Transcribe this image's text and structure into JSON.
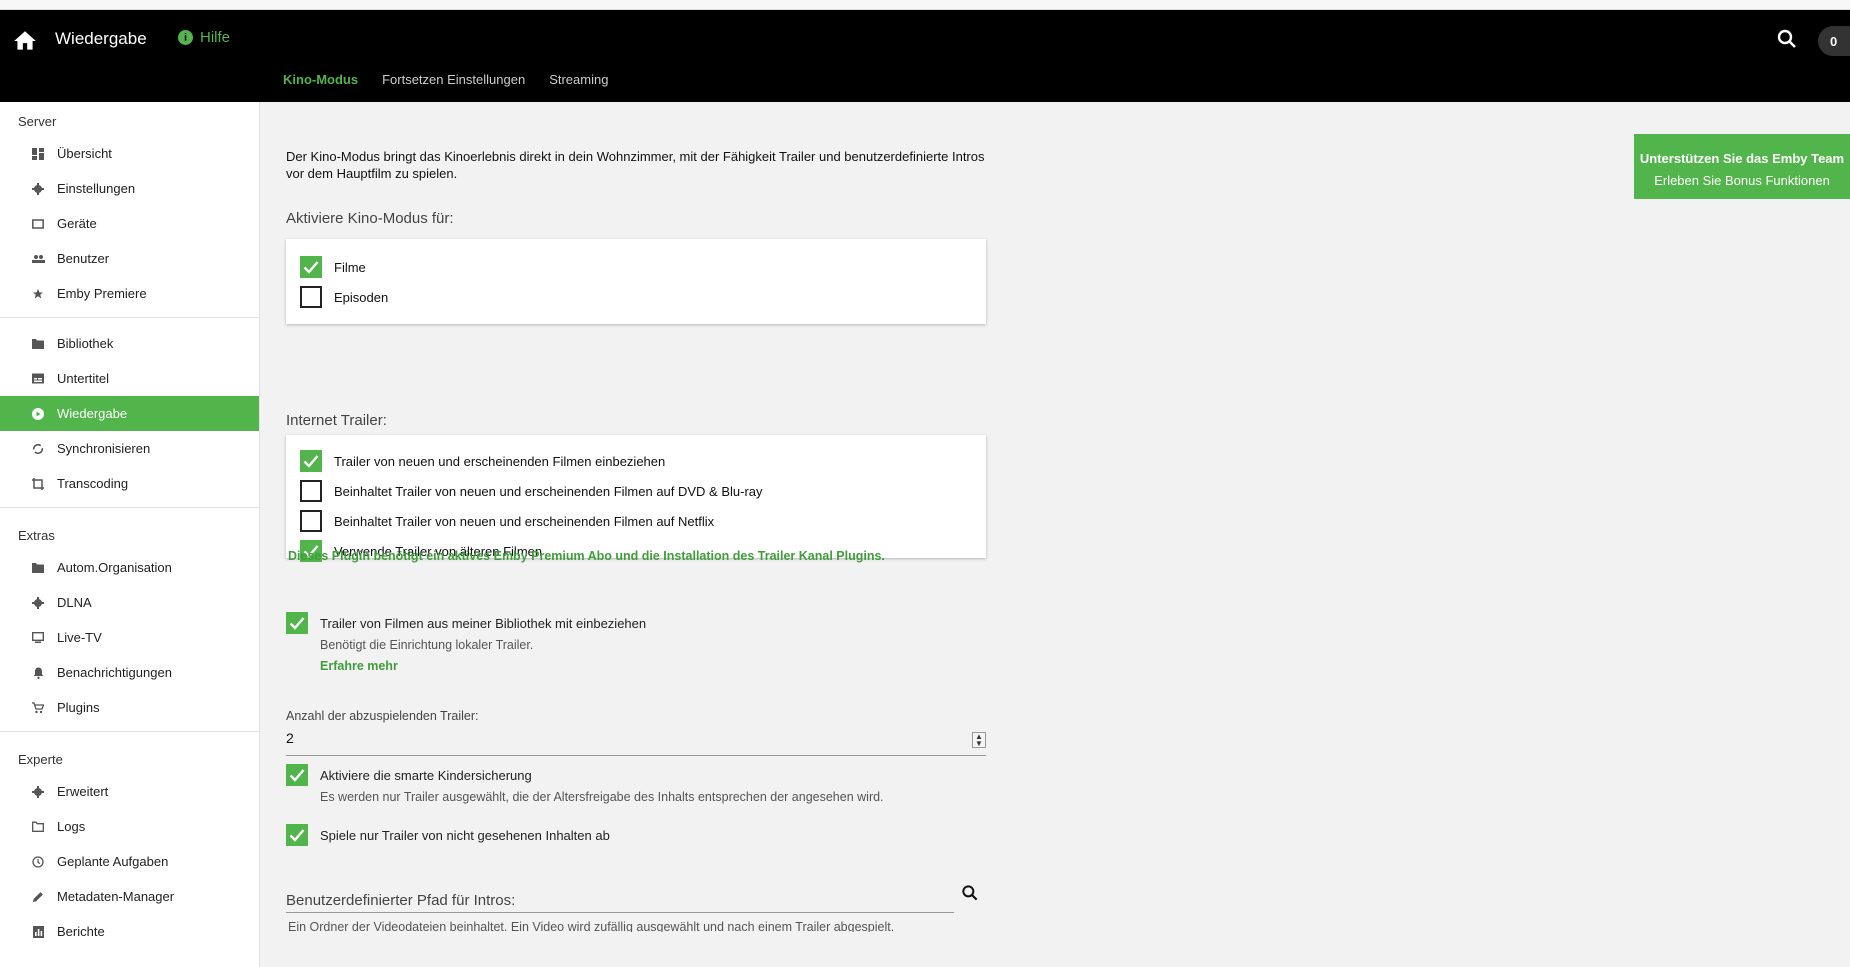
{
  "header": {
    "title": "Wiedergabe",
    "help_label": "Hilfe",
    "badge_count": "0",
    "tabs": [
      {
        "label": "Kino-Modus",
        "active": true
      },
      {
        "label": "Fortsetzen Einstellungen",
        "active": false
      },
      {
        "label": "Streaming",
        "active": false
      }
    ]
  },
  "sidebar": {
    "sections": [
      {
        "heading": "Server",
        "items": [
          {
            "label": "Übersicht",
            "icon": "dashboard-icon"
          },
          {
            "label": "Einstellungen",
            "icon": "gear-icon"
          },
          {
            "label": "Geräte",
            "icon": "devices-icon"
          },
          {
            "label": "Benutzer",
            "icon": "people-icon"
          },
          {
            "label": "Emby Premiere",
            "icon": "star-icon"
          }
        ]
      },
      {
        "heading": "",
        "items": [
          {
            "label": "Bibliothek",
            "icon": "folder-icon"
          },
          {
            "label": "Untertitel",
            "icon": "subtitles-icon"
          },
          {
            "label": "Wiedergabe",
            "icon": "play-circle-icon",
            "active": true
          },
          {
            "label": "Synchronisieren",
            "icon": "sync-icon"
          },
          {
            "label": "Transcoding",
            "icon": "transform-icon"
          }
        ]
      },
      {
        "heading": "Extras",
        "items": [
          {
            "label": "Autom.Organisation",
            "icon": "folder-icon"
          },
          {
            "label": "DLNA",
            "icon": "gear-icon"
          },
          {
            "label": "Live-TV",
            "icon": "tv-icon"
          },
          {
            "label": "Benachrichtigungen",
            "icon": "bell-icon"
          },
          {
            "label": "Plugins",
            "icon": "cart-icon"
          }
        ]
      },
      {
        "heading": "Experte",
        "items": [
          {
            "label": "Erweitert",
            "icon": "gear-icon"
          },
          {
            "label": "Logs",
            "icon": "folder-outline-icon"
          },
          {
            "label": "Geplante Aufgaben",
            "icon": "clock-icon"
          },
          {
            "label": "Metadaten-Manager",
            "icon": "pencil-icon"
          },
          {
            "label": "Berichte",
            "icon": "report-icon"
          }
        ]
      }
    ]
  },
  "support": {
    "line1": "Unterstützen Sie das Emby Team",
    "line2": "Erleben Sie Bonus Funktionen"
  },
  "main": {
    "intro": "Der Kino-Modus bringt das Kinoerlebnis direkt in dein Wohnzimmer, mit der Fähigkeit Trailer und benutzerdefinierte Intros vor dem Hauptfilm zu spielen.",
    "enable_heading": "Aktiviere Kino-Modus für:",
    "enable_options": [
      {
        "label": "Filme",
        "checked": true
      },
      {
        "label": "Episoden",
        "checked": false
      }
    ],
    "internet_heading": "Internet Trailer:",
    "internet_options": [
      {
        "label": "Trailer von neuen und erscheinenden Filmen einbeziehen",
        "checked": true
      },
      {
        "label": "Beinhaltet Trailer von neuen und erscheinenden Filmen auf DVD & Blu-ray",
        "checked": false
      },
      {
        "label": "Beinhaltet Trailer von neuen und erscheinenden Filmen auf Netflix",
        "checked": false
      },
      {
        "label": "Verwende Trailer von älteren Filmen",
        "checked": true
      }
    ],
    "plugin_note": "Dieses Plugin benötigt ein aktives Emby Premium Abo und die Installation des Trailer Kanal Plugins.",
    "library_trailers": {
      "label": "Trailer von Filmen aus meiner Bibliothek mit einbeziehen",
      "checked": true,
      "description": "Benötigt die Einrichtung lokaler Trailer.",
      "learn_more": "Erfahre mehr"
    },
    "count_label": "Anzahl der abzuspielenden Trailer:",
    "count_value": "2",
    "parental": {
      "label": "Aktiviere die smarte Kindersicherung",
      "checked": true,
      "description": "Es werden nur Trailer ausgewählt, die der Altersfreigabe des Inhalts entsprechen der angesehen wird."
    },
    "unwatched": {
      "label": "Spiele nur Trailer von nicht gesehenen Inhalten ab",
      "checked": true
    },
    "intro_path_label": "Benutzerdefinierter Pfad für Intros:",
    "intro_path_note": "Ein Ordner der Videodateien beinhaltet. Ein Video wird zufällig ausgewählt und nach einem Trailer abgespielt."
  },
  "colors": {
    "accent": "#52b54b",
    "topbar": "#000000"
  }
}
